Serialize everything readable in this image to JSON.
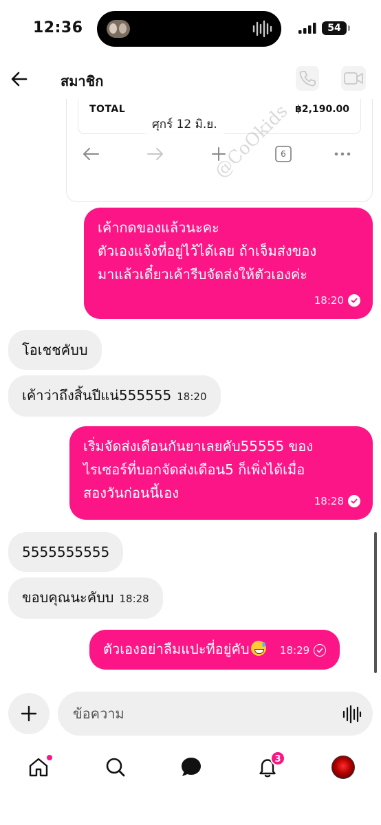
{
  "status_bar": {
    "time": "12:36",
    "battery": "54"
  },
  "header": {
    "title": "สมาชิก"
  },
  "shared_card": {
    "watermark": "@CoOkids",
    "total_label": "TOTAL",
    "total_value": "฿2,190.00",
    "tab_count": "6"
  },
  "date_separator": "ศุกร์ 12 มิ.ย.",
  "messages": [
    {
      "direction": "out",
      "lines": [
        "เค้ากดของแล้วนะคะ",
        "ตัวเองแจ้งที่อยู่ไว้ได้เลย ถ้าเจ็มส่งของ",
        "มาแล้วเดี๋ยวเค้ารีบจัดส่งให้ตัวเองค่ะ"
      ],
      "time": "18:20",
      "status": "read"
    },
    {
      "direction": "in",
      "text": "โอเชชคับบ",
      "time": ""
    },
    {
      "direction": "in",
      "text": "เค้าว่าถึงสิ้นปีแน่555555",
      "time": "18:20"
    },
    {
      "direction": "out",
      "lines": [
        "เริ่มจัดส่งเดือนกันยาเลยคับ55555 ของ",
        "ไรเซอร์ที่บอกจัดส่งเดือน5 ก็เพิ่งได้เมื่อ",
        "สองวันก่อนนี้เอง"
      ],
      "time": "18:28",
      "status": "read"
    },
    {
      "direction": "in",
      "text": "5555555555",
      "time": ""
    },
    {
      "direction": "in",
      "text": "ขอบคุณนะคับบ",
      "time": "18:28"
    },
    {
      "direction": "out",
      "lines": [
        "ตัวเองอย่าลืมแปะที่อยู่คับ"
      ],
      "emoji": "sweat-smile",
      "time": "18:29",
      "status": "sent"
    }
  ],
  "composer": {
    "placeholder": "ข้อความ"
  },
  "nav": {
    "notification_count": "3"
  },
  "colors": {
    "accent": "#fb1586",
    "incoming_bubble": "#efefef"
  }
}
